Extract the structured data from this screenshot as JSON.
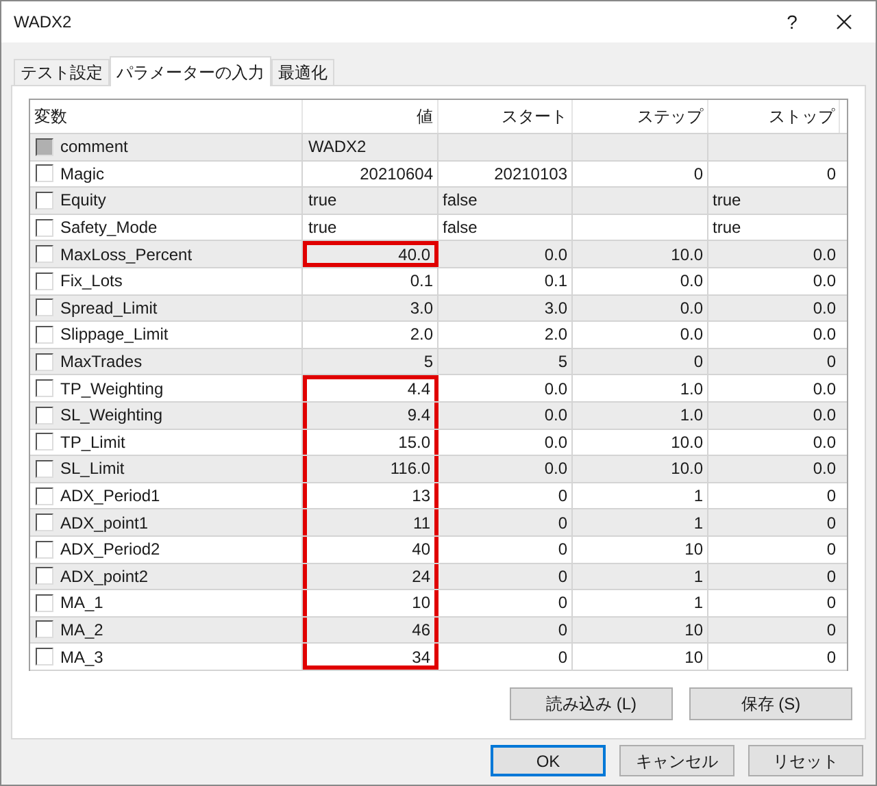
{
  "window": {
    "title": "WADX2",
    "help": "?"
  },
  "tabs": [
    {
      "label": "テスト設定",
      "selected": false
    },
    {
      "label": "パラメーターの入力",
      "selected": true
    },
    {
      "label": "最適化",
      "selected": false
    }
  ],
  "table": {
    "columns": [
      "変数",
      "値",
      "スタート",
      "ステップ",
      "ストップ"
    ],
    "rows": [
      {
        "name": "comment",
        "checked": false,
        "disabled": true,
        "highlighted": false,
        "value": "WADX2",
        "kind": "text"
      },
      {
        "name": "Magic",
        "checked": false,
        "disabled": false,
        "highlighted": false,
        "value": "20210604",
        "start": "20210103",
        "step": "0",
        "stop": "0",
        "kind": "number"
      },
      {
        "name": "Equity",
        "checked": false,
        "disabled": false,
        "highlighted": false,
        "value": "true",
        "start": "false",
        "stop": "true",
        "kind": "text"
      },
      {
        "name": "Safety_Mode",
        "checked": false,
        "disabled": false,
        "highlighted": false,
        "value": "true",
        "start": "false",
        "stop": "true",
        "kind": "text"
      },
      {
        "name": "MaxLoss_Percent",
        "checked": false,
        "disabled": false,
        "highlighted": true,
        "value": "40.0",
        "start": "0.0",
        "step": "10.0",
        "stop": "0.0",
        "kind": "number"
      },
      {
        "name": "Fix_Lots",
        "checked": false,
        "disabled": false,
        "highlighted": false,
        "value": "0.1",
        "start": "0.1",
        "step": "0.0",
        "stop": "0.0",
        "kind": "number"
      },
      {
        "name": "Spread_Limit",
        "checked": false,
        "disabled": false,
        "highlighted": false,
        "value": "3.0",
        "start": "3.0",
        "step": "0.0",
        "stop": "0.0",
        "kind": "number"
      },
      {
        "name": "Slippage_Limit",
        "checked": false,
        "disabled": false,
        "highlighted": false,
        "value": "2.0",
        "start": "2.0",
        "step": "0.0",
        "stop": "0.0",
        "kind": "number"
      },
      {
        "name": "MaxTrades",
        "checked": false,
        "disabled": false,
        "highlighted": false,
        "value": "5",
        "start": "5",
        "step": "0",
        "stop": "0",
        "kind": "number"
      },
      {
        "name": "TP_Weighting",
        "checked": false,
        "disabled": false,
        "highlighted": true,
        "value": "4.4",
        "start": "0.0",
        "step": "1.0",
        "stop": "0.0",
        "kind": "number"
      },
      {
        "name": "SL_Weighting",
        "checked": false,
        "disabled": false,
        "highlighted": true,
        "value": "9.4",
        "start": "0.0",
        "step": "1.0",
        "stop": "0.0",
        "kind": "number"
      },
      {
        "name": "TP_Limit",
        "checked": false,
        "disabled": false,
        "highlighted": true,
        "value": "15.0",
        "start": "0.0",
        "step": "10.0",
        "stop": "0.0",
        "kind": "number"
      },
      {
        "name": "SL_Limit",
        "checked": false,
        "disabled": false,
        "highlighted": true,
        "value": "116.0",
        "start": "0.0",
        "step": "10.0",
        "stop": "0.0",
        "kind": "number"
      },
      {
        "name": "ADX_Period1",
        "checked": false,
        "disabled": false,
        "highlighted": true,
        "value": "13",
        "start": "0",
        "step": "1",
        "stop": "0",
        "kind": "number"
      },
      {
        "name": "ADX_point1",
        "checked": false,
        "disabled": false,
        "highlighted": true,
        "value": "11",
        "start": "0",
        "step": "1",
        "stop": "0",
        "kind": "number"
      },
      {
        "name": "ADX_Period2",
        "checked": false,
        "disabled": false,
        "highlighted": true,
        "value": "40",
        "start": "0",
        "step": "10",
        "stop": "0",
        "kind": "number"
      },
      {
        "name": "ADX_point2",
        "checked": false,
        "disabled": false,
        "highlighted": true,
        "value": "24",
        "start": "0",
        "step": "1",
        "stop": "0",
        "kind": "number"
      },
      {
        "name": "MA_1",
        "checked": false,
        "disabled": false,
        "highlighted": true,
        "value": "10",
        "start": "0",
        "step": "1",
        "stop": "0",
        "kind": "number"
      },
      {
        "name": "MA_2",
        "checked": false,
        "disabled": false,
        "highlighted": true,
        "value": "46",
        "start": "0",
        "step": "10",
        "stop": "0",
        "kind": "number"
      },
      {
        "name": "MA_3",
        "checked": false,
        "disabled": false,
        "highlighted": true,
        "value": "34",
        "start": "0",
        "step": "10",
        "stop": "0",
        "kind": "number"
      }
    ]
  },
  "panel_buttons": [
    "読み込み (L)",
    "保存 (S)"
  ],
  "dialog_buttons": [
    {
      "label": "OK",
      "default": true
    },
    {
      "label": "キャンセル",
      "default": false
    },
    {
      "label": "リセット",
      "default": false
    }
  ]
}
